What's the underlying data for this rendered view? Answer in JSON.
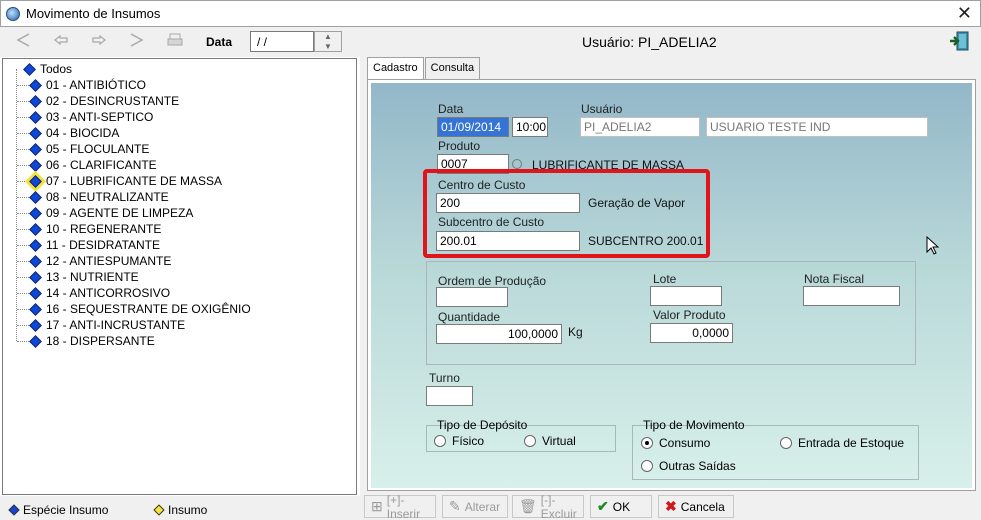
{
  "window": {
    "title": "Movimento de Insumos",
    "close_glyph": "✕"
  },
  "toolbar": {
    "buttons": [
      "first-icon",
      "prev-icon",
      "next-icon",
      "last-icon",
      "print-icon"
    ],
    "date_label": "Data",
    "date_value": " / /",
    "user_label": "Usuário: PI_ADELIA2"
  },
  "tree": {
    "root": "Todos",
    "items": [
      "01 - ANTIBIÓTICO",
      "02 - DESINCRUSTANTE",
      "03 - ANTI-SEPTICO",
      "04 - BIOCIDA",
      "05 - FLOCULANTE",
      "06 - CLARIFICANTE",
      "07 - LUBRIFICANTE DE MASSA",
      "08 - NEUTRALIZANTE",
      "09 - AGENTE DE LIMPEZA",
      "10 - REGENERANTE",
      "11 - DESIDRATANTE",
      "12 - ANTIESPUMANTE",
      "13 - NUTRIENTE",
      "14 - ANTICORROSIVO",
      "16 - SEQUESTRANTE DE OXIGÊNIO",
      "17 - ANTI-INCRUSTANTE",
      "18 - DISPERSANTE"
    ],
    "selected_index": 6
  },
  "legend": {
    "especie": "Espécie Insumo",
    "insumo": "Insumo"
  },
  "tabs": [
    "Cadastro",
    "Consulta"
  ],
  "form": {
    "data_label": "Data",
    "data_value": "01/09/2014",
    "hora_value": "10:00",
    "usuario_label": "Usuário",
    "usuario_login": "PI_ADELIA2",
    "usuario_nome": "USUARIO TESTE IND",
    "produto_label": "Produto",
    "produto_code": "0007",
    "produto_desc": "LUBRIFICANTE DE MASSA",
    "centro_label": "Centro de Custo",
    "centro_value": "200",
    "centro_desc": "Geração de Vapor",
    "subcentro_label": "Subcentro de Custo",
    "subcentro_value": "200.01",
    "subcentro_desc": "SUBCENTRO 200.01",
    "ordem_label": "Ordem de Produção",
    "ordem_value": "",
    "lote_label": "Lote",
    "lote_value": "",
    "nota_label": "Nota Fiscal",
    "nota_value": "",
    "quantidade_label": "Quantidade",
    "quantidade_value": "100,0000",
    "quantidade_unit": "Kg",
    "valor_label": "Valor Produto",
    "valor_value": "0,0000",
    "turno_label": "Turno",
    "turno_value": "",
    "deposito": {
      "title": "Tipo de Depósito",
      "options": [
        "Físico",
        "Virtual"
      ]
    },
    "movimento": {
      "title": "Tipo de Movimento",
      "options": [
        "Consumo",
        "Entrada de Estoque",
        "Outras Saídas"
      ],
      "selected": "Consumo"
    }
  },
  "actions": {
    "inserir": "[+]-Inserir",
    "alterar": "Alterar",
    "excluir": "[-]-Excluir",
    "ok": "OK",
    "cancela": "Cancela"
  }
}
